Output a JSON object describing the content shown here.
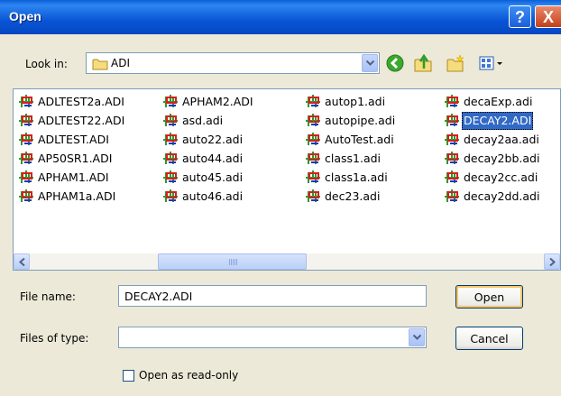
{
  "title": "Open",
  "titlebar": {
    "help": "?",
    "close": "X"
  },
  "look_in": {
    "label": "Look in:",
    "value": "ADI"
  },
  "toolbar": {
    "icons": [
      "back-icon",
      "up-folder-icon",
      "new-folder-icon",
      "views-menu-icon"
    ]
  },
  "files": [
    "ADLTEST2a.ADI",
    "ADLTEST22.ADI",
    "ADLTEST.ADI",
    "AP50SR1.ADI",
    "APHAM1.ADI",
    "APHAM1a.ADI",
    "APHAM2.ADI",
    "asd.adi",
    "auto22.adi",
    "auto44.adi",
    "auto45.adi",
    "auto46.adi",
    "autop1.adi",
    "autopipe.adi",
    "AutoTest.adi",
    "class1.adi",
    "class1a.adi",
    "dec23.adi",
    "decaExp.adi",
    "DECAY2.ADI",
    "decay2aa.adi",
    "decay2bb.adi",
    "decay2cc.adi",
    "decay2dd.adi"
  ],
  "selected_file": "DECAY2.ADI",
  "file_name": {
    "label": "File name:",
    "value": "DECAY2.ADI"
  },
  "file_type": {
    "label": "Files of type:",
    "value": ""
  },
  "buttons": {
    "open": "Open",
    "cancel": "Cancel"
  },
  "readonly": {
    "label": "Open as read-only",
    "checked": false
  },
  "colors": {
    "title_bar": "#0A5FD8",
    "selection": "#316AC5",
    "face": "#ECE9D8"
  }
}
